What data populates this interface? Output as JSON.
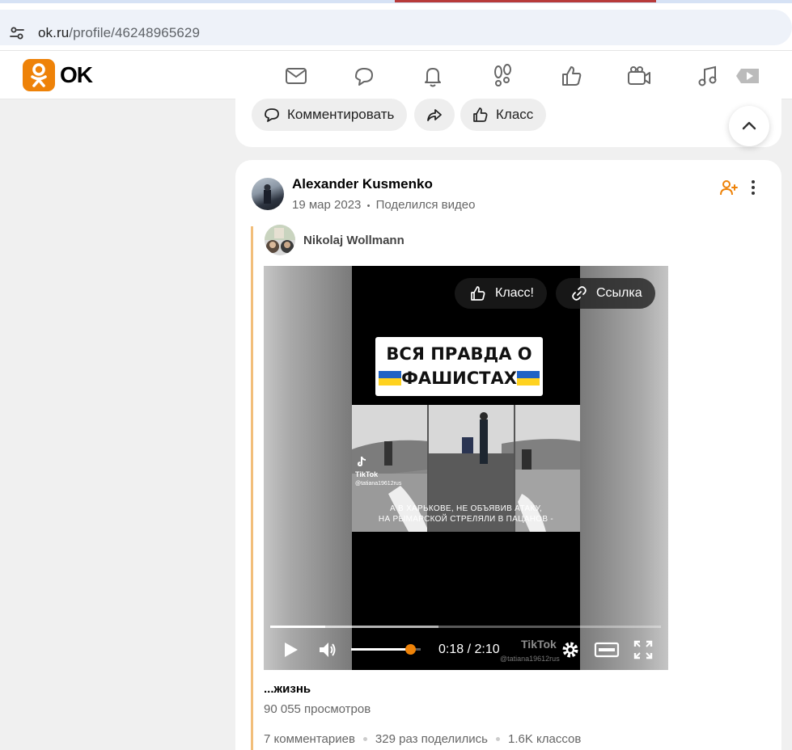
{
  "browser": {
    "url_host": "ok.ru",
    "url_path": "/profile/46248965629"
  },
  "header": {
    "logo_text": "OK",
    "brand_color": "#ee8208",
    "nav_icons": [
      "mail-icon",
      "chat-icon",
      "bell-icon",
      "footprints-icon",
      "like-icon",
      "video-camera-icon",
      "music-icon",
      "video-icon"
    ]
  },
  "prev_post": {
    "comment_label": "Комментировать",
    "share_icon": "share-icon",
    "like_label": "Класс"
  },
  "post": {
    "author": "Alexander Kusmenko",
    "date": "19 мар 2023",
    "separator": "•",
    "action": "Поделился видео",
    "original_author": "Nikolaj Wollmann",
    "video": {
      "like_label": "Класс!",
      "link_label": "Ссылка",
      "title_line1": "ВСЯ ПРАВДА О",
      "title_line2": "ФАШИСТАХ",
      "tiktok_label": "TikTok",
      "tiktok_user": "@tatiana19612rus",
      "caption_line1": "А В ХАРЬКОВЕ, НЕ ОБЪЯВИВ АТАКУ,",
      "caption_line2": "НА РЫМАРСКОЙ СТРЕЛЯЛИ В ПАЦАНОВ -",
      "time": "0:18 / 2:10",
      "progress_played": 0.14,
      "progress_buffered": 0.43,
      "volume": 0.85,
      "watermark": "TikTok",
      "watermark_user": "@tatiana19612rus"
    },
    "video_title": "...жизнь",
    "views": "90 055 просмотров",
    "comments": "7 комментариев",
    "shares": "329 раз поделились",
    "likes": "1.6K классов"
  }
}
